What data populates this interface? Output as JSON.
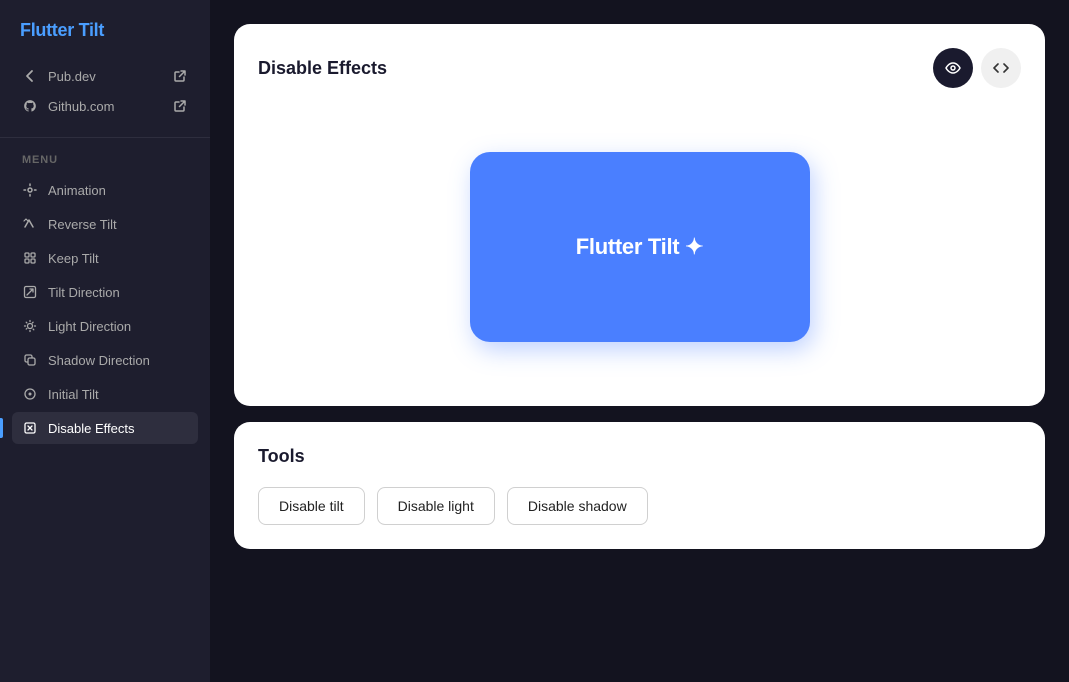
{
  "app": {
    "title": "Flutter Tilt",
    "title_prefix": "F",
    "title_rest": "lutter Tilt"
  },
  "sidebar": {
    "links": [
      {
        "id": "pub-dev",
        "label": "Pub.dev",
        "icon": "external-link-icon"
      },
      {
        "id": "github",
        "label": "Github.com",
        "icon": "github-icon"
      }
    ],
    "section_label": "MENU",
    "items": [
      {
        "id": "animation",
        "label": "Animation",
        "icon": "animation-icon",
        "active": false
      },
      {
        "id": "reverse-tilt",
        "label": "Reverse Tilt",
        "icon": "reverse-tilt-icon",
        "active": false
      },
      {
        "id": "keep-tilt",
        "label": "Keep Tilt",
        "icon": "keep-tilt-icon",
        "active": false
      },
      {
        "id": "tilt-direction",
        "label": "Tilt Direction",
        "icon": "tilt-direction-icon",
        "active": false
      },
      {
        "id": "light-direction",
        "label": "Light Direction",
        "icon": "light-direction-icon",
        "active": false
      },
      {
        "id": "shadow-direction",
        "label": "Shadow Direction",
        "icon": "shadow-direction-icon",
        "active": false
      },
      {
        "id": "initial-tilt",
        "label": "Initial Tilt",
        "icon": "initial-tilt-icon",
        "active": false
      },
      {
        "id": "disable-effects",
        "label": "Disable Effects",
        "icon": "disable-effects-icon",
        "active": true
      }
    ]
  },
  "demo": {
    "title": "Disable Effects",
    "preview_btn_icon": "eye-icon",
    "code_btn_icon": "code-icon",
    "tilt_box_text": "Flutter Tilt ✦"
  },
  "tools": {
    "title": "Tools",
    "buttons": [
      {
        "id": "disable-tilt",
        "label": "Disable tilt"
      },
      {
        "id": "disable-light",
        "label": "Disable light"
      },
      {
        "id": "disable-shadow",
        "label": "Disable shadow"
      }
    ]
  }
}
